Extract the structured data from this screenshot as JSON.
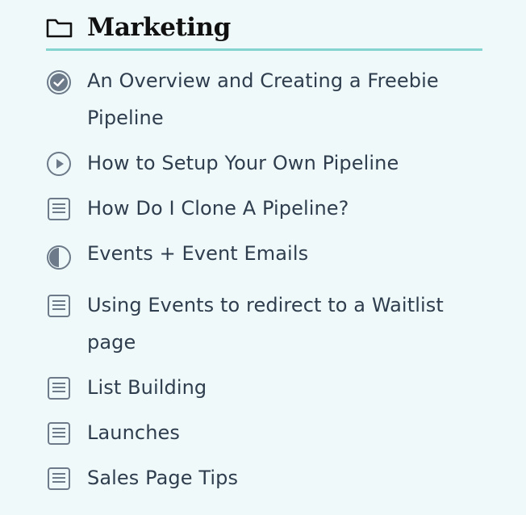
{
  "section": {
    "title": "Marketing",
    "icon": "folder-icon",
    "underline_color": "#86d4cf"
  },
  "lessons": [
    {
      "label": "An Overview and Creating a Freebie Pipeline",
      "icon": "check-circle-icon",
      "status": "completed"
    },
    {
      "label": "How to Setup Your Own Pipeline",
      "icon": "play-circle-icon",
      "status": "video"
    },
    {
      "label": "How Do I Clone A Pipeline?",
      "icon": "document-icon",
      "status": "text"
    },
    {
      "label": "Events + Event Emails",
      "icon": "half-circle-icon",
      "status": "in-progress"
    },
    {
      "label": "Using Events to redirect to a Waitlist page",
      "icon": "document-icon",
      "status": "text"
    },
    {
      "label": "List Building",
      "icon": "document-icon",
      "status": "text"
    },
    {
      "label": "Launches",
      "icon": "document-icon",
      "status": "text"
    },
    {
      "label": "Sales Page Tips",
      "icon": "document-icon",
      "status": "text"
    }
  ]
}
